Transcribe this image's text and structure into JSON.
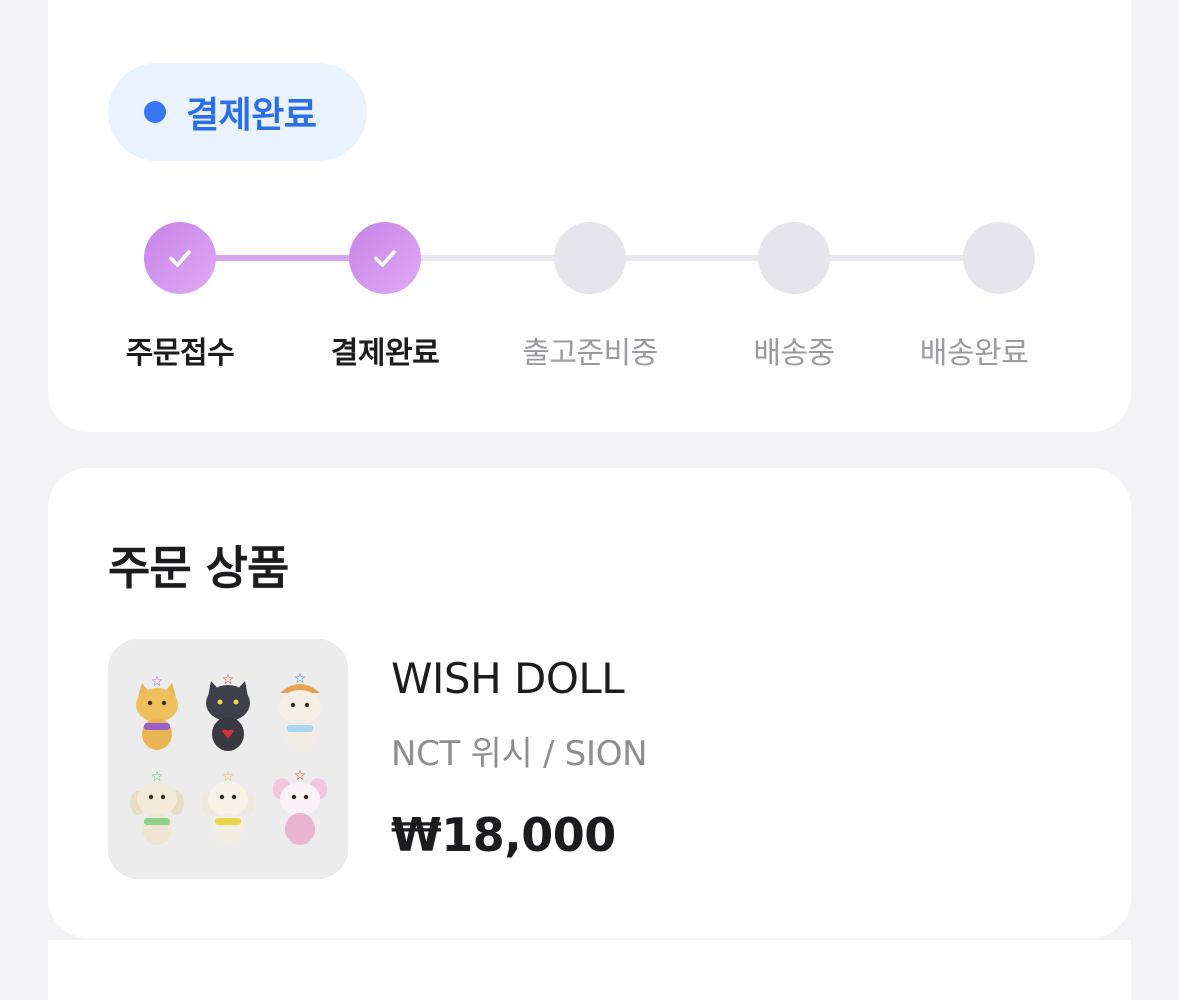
{
  "order_status": {
    "badge_label": "결제완료",
    "badge_color": "#3478f6",
    "steps": [
      {
        "label": "주문접수",
        "done": true
      },
      {
        "label": "결제완료",
        "done": true
      },
      {
        "label": "출고준비중",
        "done": false
      },
      {
        "label": "배송중",
        "done": false
      },
      {
        "label": "배송완료",
        "done": false
      }
    ],
    "progress_color": "#d8a6ef"
  },
  "products_section": {
    "title": "주문 상품",
    "items": [
      {
        "name": "WISH DOLL",
        "option": "NCT 위시 / SION",
        "price": "₩18,000",
        "thumbnail": "wish-doll-plush-set-image"
      }
    ]
  }
}
